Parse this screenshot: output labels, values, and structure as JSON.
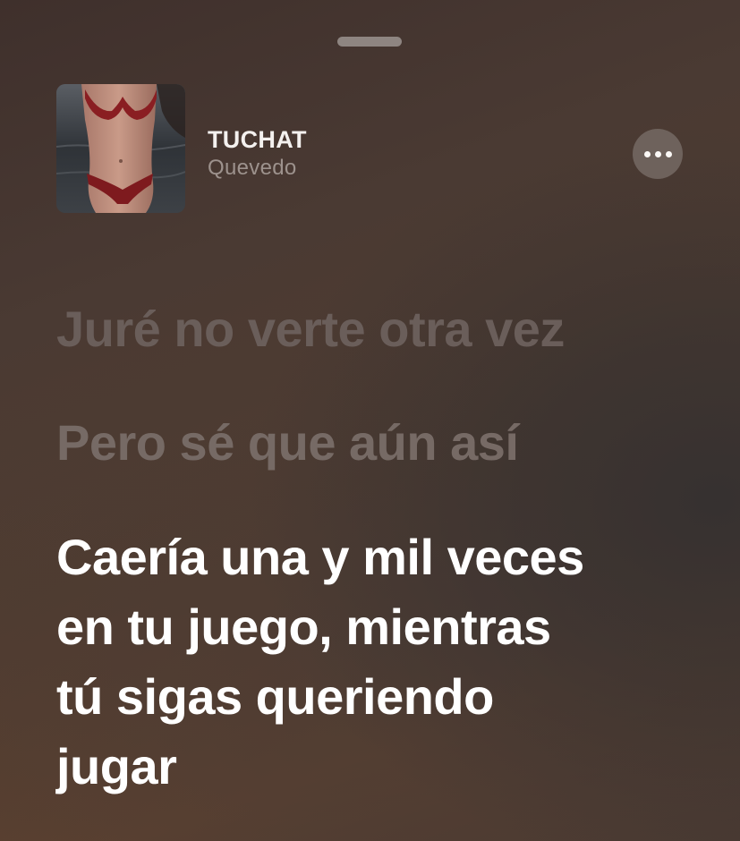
{
  "song": {
    "title": "TUCHAT",
    "artist": "Quevedo"
  },
  "lyrics": {
    "previous_lines": [
      "Juré no verte otra vez",
      "Pero sé que aún así"
    ],
    "current_line": "Caería una y mil veces en tu juego, mientras tú sigas queriendo jugar"
  },
  "icons": {
    "grabber": "sheet-grabber",
    "more": "more-horizontal-icon"
  },
  "colors": {
    "active_lyric": "#ffffff",
    "inactive_lyric": "#6a5e5a",
    "artist_text": "#9d928d"
  }
}
